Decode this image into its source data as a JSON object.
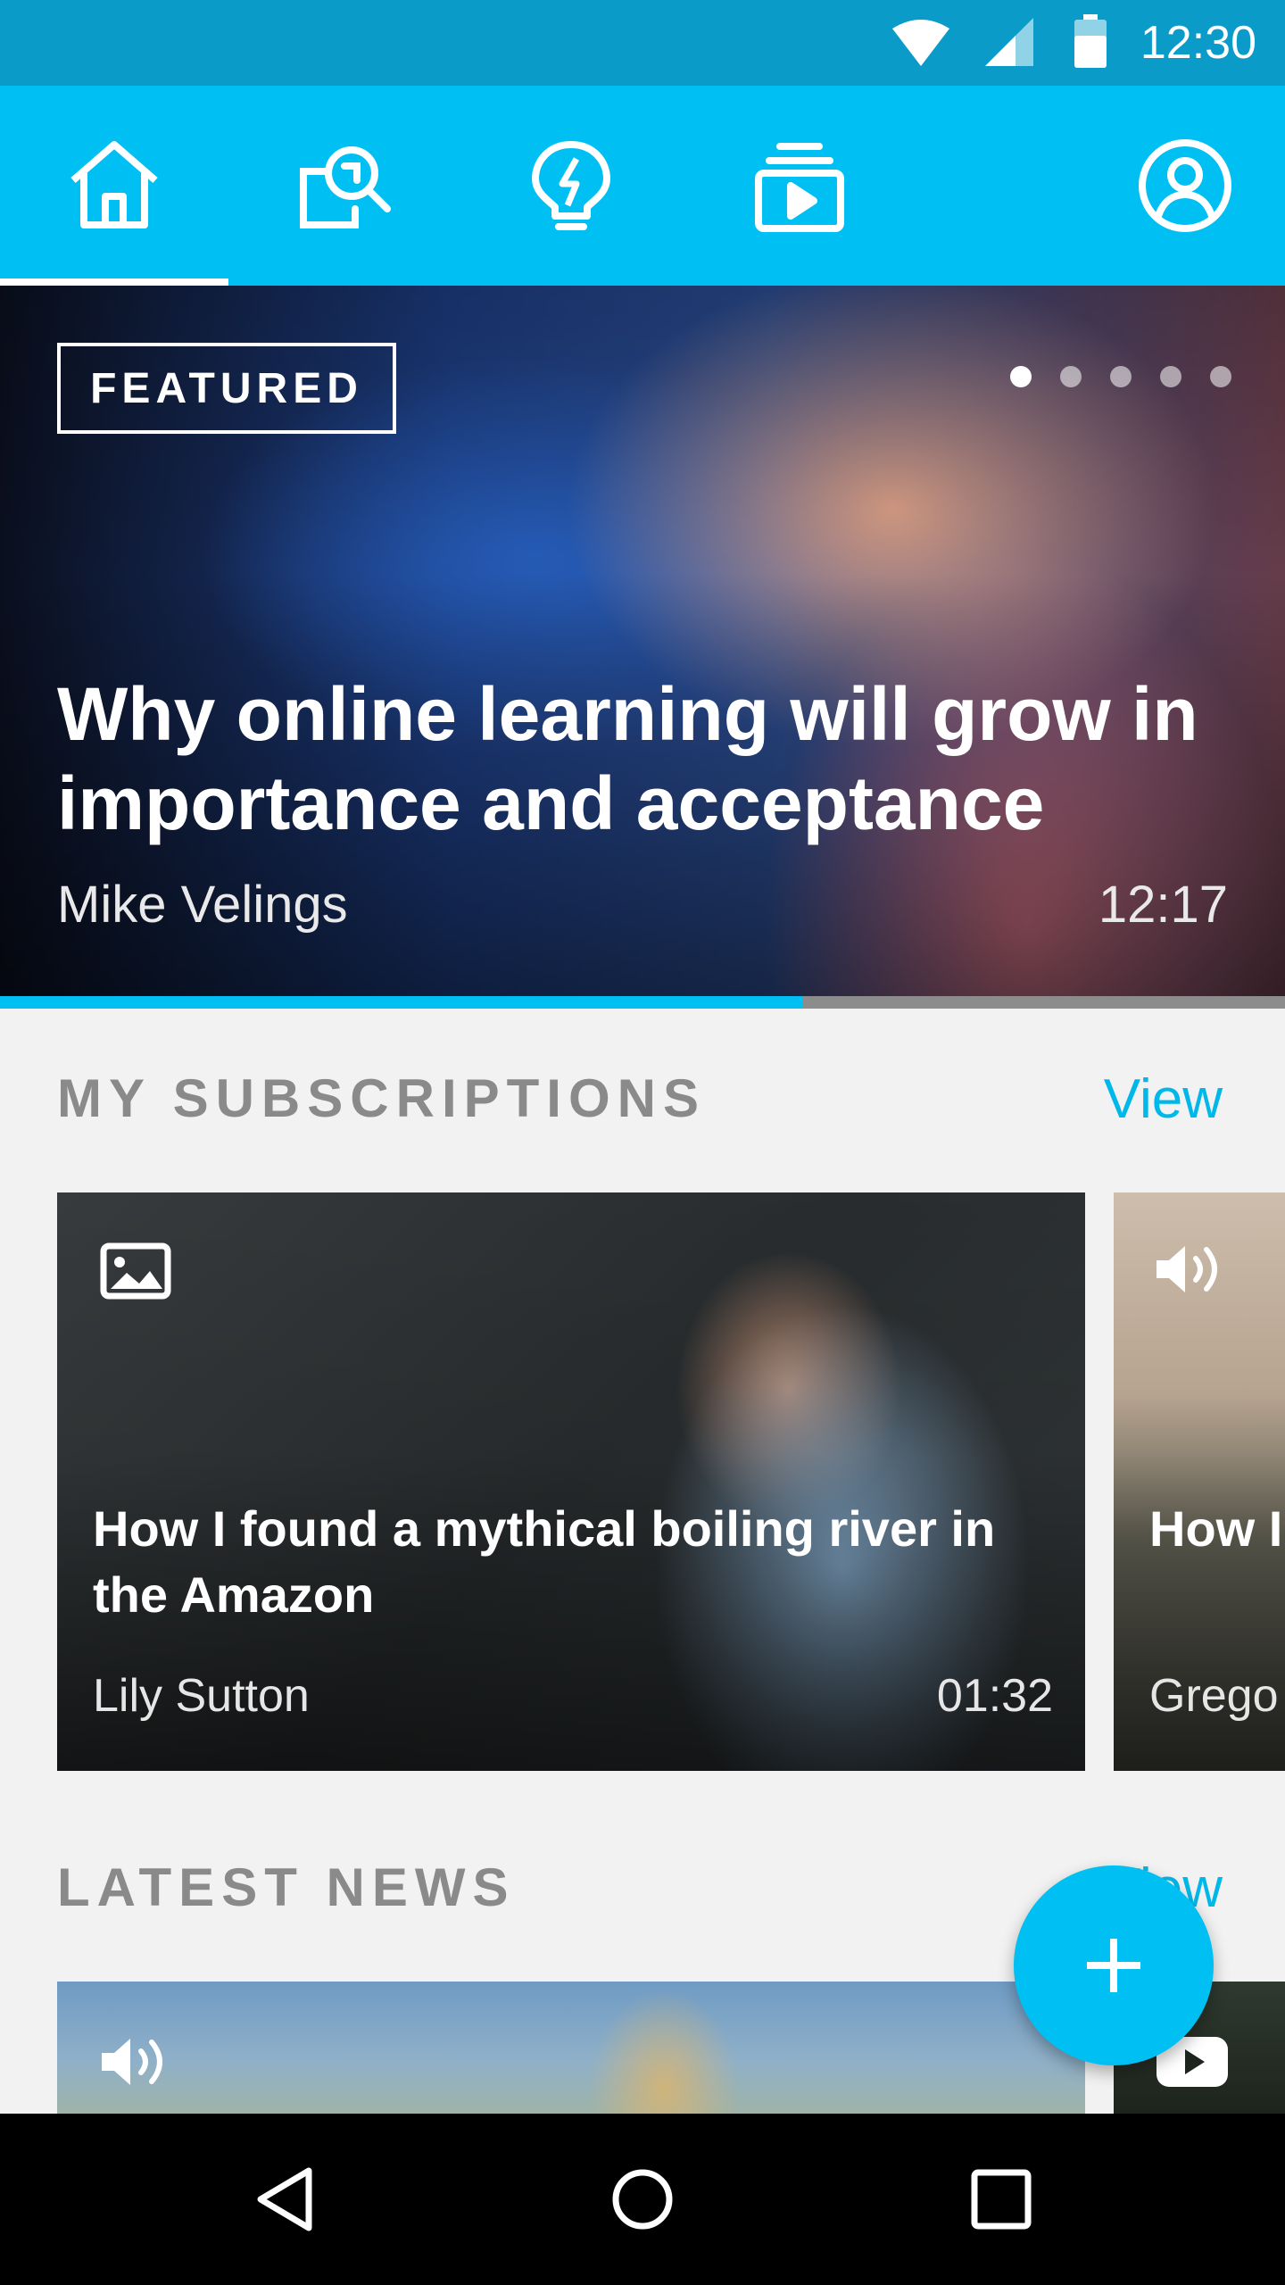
{
  "status_bar": {
    "time": "12:30"
  },
  "top_nav": {
    "items": [
      "home",
      "search",
      "ideas",
      "library",
      "profile"
    ],
    "active": "home"
  },
  "featured": {
    "badge": "FEATURED",
    "title": "Why online learning will grow in importance and acceptance",
    "author": "Mike Velings",
    "duration": "12:17",
    "slides_total": 5,
    "slide_active": 1,
    "progress": 0.625
  },
  "subscriptions": {
    "title": "MY SUBSCRIPTIONS",
    "view_label": "View",
    "cards": [
      {
        "type": "image",
        "icon": "image-icon",
        "title": "How I found a mythical boiling river in the Amazon",
        "author": "Lily Sutton",
        "duration": "01:32"
      },
      {
        "type": "audio",
        "icon": "audio-icon",
        "title": "How I ancie",
        "author": "Grego"
      }
    ]
  },
  "latest_news": {
    "title": "LATEST NEWS",
    "view_label": "View",
    "cards": [
      {
        "type": "audio",
        "icon": "audio-icon"
      },
      {
        "type": "video",
        "icon": "youtube-icon"
      }
    ]
  },
  "fab": {
    "icon": "plus-icon"
  },
  "colors": {
    "accent": "#00c0f3",
    "status_bar": "#0b9bc8",
    "background": "#f2f2f2"
  }
}
